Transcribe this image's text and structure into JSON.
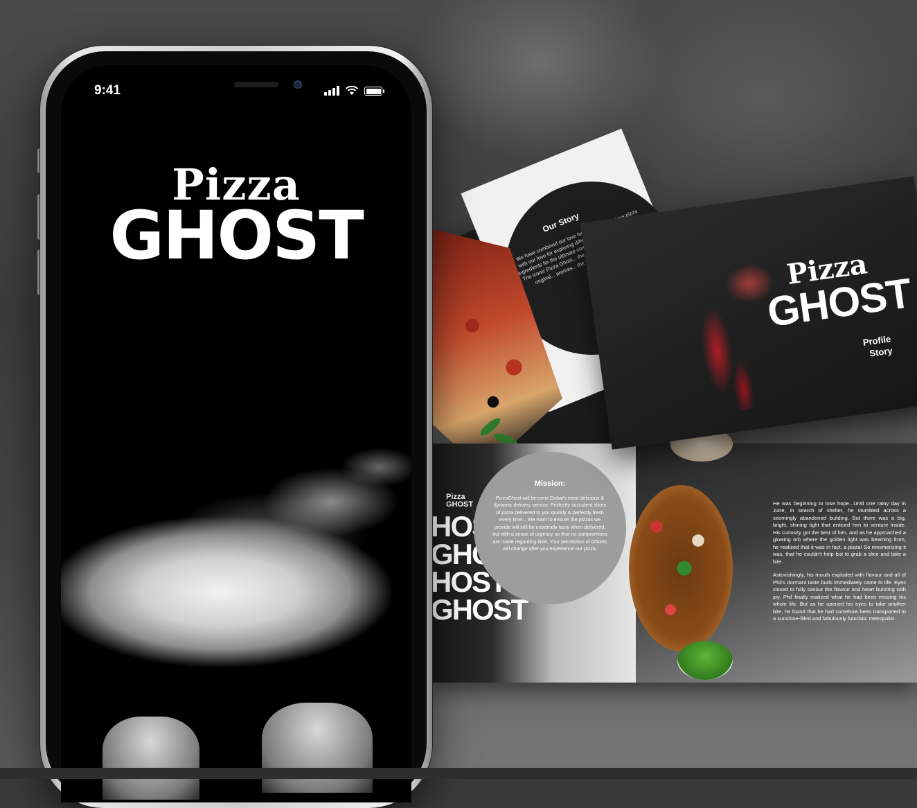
{
  "phone": {
    "time": "9:41",
    "logo_top": "Pizza",
    "logo_bottom": "GHOST"
  },
  "brochure": {
    "story_title": "Our Story",
    "story_text": "We have combined our love for fresh and delicious pizza with our love for exploring different cuisines, cultures and ingredients for the ultimate comfort food that feeds the soul. The iconic Pizza Ghost... the city of... the birthplace of the original... aromas... the soul of flavors, different...",
    "cover_top": "Pizza",
    "cover_bottom": "GHOST",
    "cover_sub_1": "Profile",
    "cover_sub_2": "Story",
    "mini_logo_top": "Pizza",
    "mini_logo_bottom": "GHOST",
    "ghost_pattern": "HOST GHOST HOST GHOST",
    "mission_title": "Mission:",
    "mission_text": "PizzaGhost will become Dubai's most delicious & dynamic delivery service: Perfectly succulent slices of pizza delivered to you quickly & perfectly fresh every time... We want to ensure the pizzas we provide will still be extremely tasty when delivered, but with a sense of urgency so that no compromises are made regarding time. Your perception of Ghosts will change after you experience our pizza.",
    "story_p1": "He was beginning to lose hope...Until one rainy day in June, in search of shelter, he stumbled across a seemingly abandoned building. But there was a big, bright, shining light that enticed him to venture inside. His curiosity got the best of him, and as he approached a glowing orb where the golden light was beaming from, he realized that it was in fact, a pizza! So mesmerizing it was, that he couldn't help but to grab a slice and take a bite.",
    "story_p2": "Astonishingly, his mouth exploded with flavour and all of Phil's dormant taste buds immediately came to life. Eyes closed to fully savour the flavour and heart bursting with joy, Phil finally realized what he had been missing his whole life. But as he opened his eyes to take another bite, he found that he had somehow been transported to a sunshine-filled and fabulously futuristic metropolis!"
  }
}
